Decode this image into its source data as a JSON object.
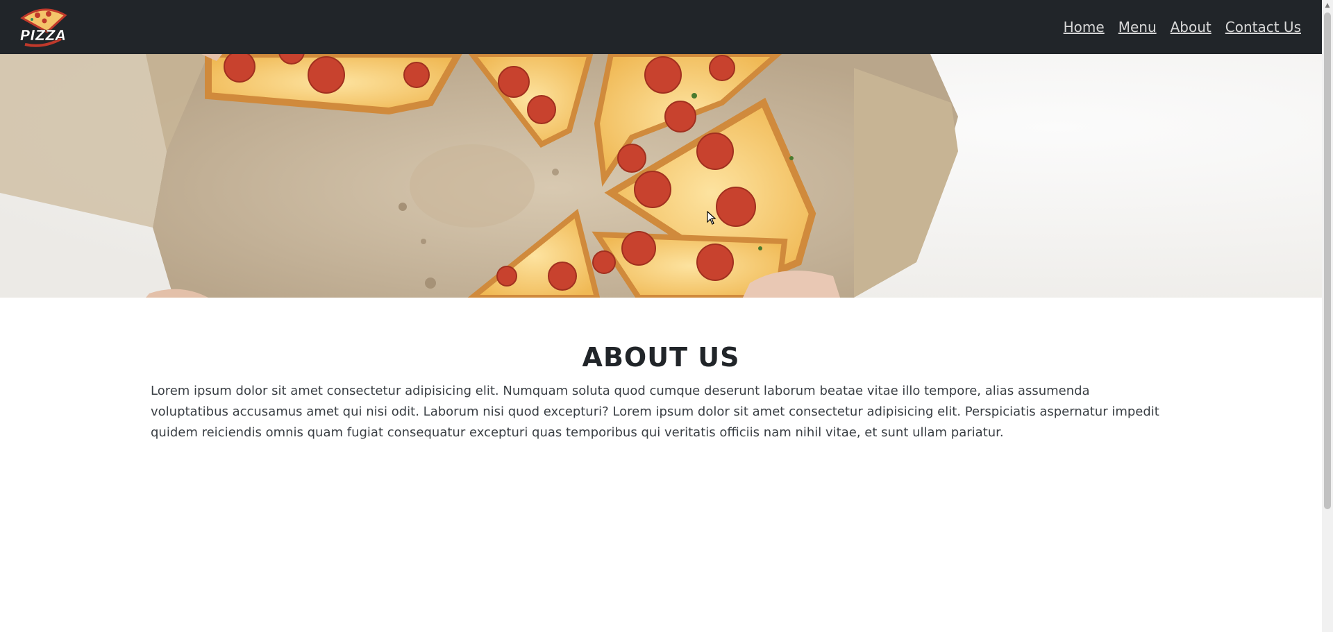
{
  "brand": {
    "logo_text": "PIZZA"
  },
  "nav": {
    "items": [
      "Home",
      "Menu",
      "About",
      "Contact Us"
    ]
  },
  "about": {
    "title": "ABOUT US",
    "text": "Lorem ipsum dolor sit amet consectetur adipisicing elit. Numquam soluta quod cumque deserunt laborum beatae vitae illo tempore, alias assumenda voluptatibus accusamus amet qui nisi odit. Laborum nisi quod excepturi? Lorem ipsum dolor sit amet consectetur adipisicing elit. Perspiciatis aspernatur impedit quidem reiciendis omnis quam fugiat consequatur excepturi quas temporibus qui veritatis officiis nam nihil vitae, et sunt ullam pariatur."
  },
  "colors": {
    "navbar": "#212529",
    "nav_link": "#d8d8d8",
    "text": "#212529"
  },
  "icons": {
    "logo": "pizza-logo-icon",
    "scroll_up": "scroll-up-arrow-icon",
    "cursor": "mouse-cursor-icon"
  }
}
